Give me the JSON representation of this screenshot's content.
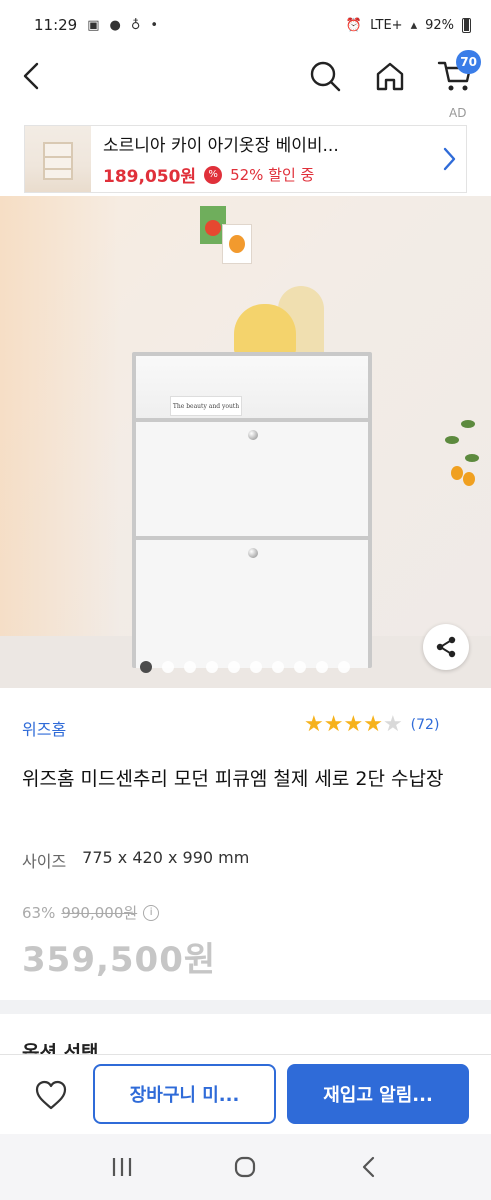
{
  "status_bar": {
    "time": "11:29",
    "network": "LTE+",
    "battery": "92%"
  },
  "header": {
    "cart_count": "70"
  },
  "ad": {
    "tag": "AD",
    "title": "소르니아 카이 아기옷장 베이비...",
    "price": "189,050원",
    "discount_icon": "%",
    "discount": "52% 할인 중"
  },
  "product_image": {
    "book_text": "The beauty and youth",
    "dot_count": 10,
    "active_dot": 0
  },
  "product": {
    "brand": "위즈홈",
    "rating": 4,
    "rating_max": 5,
    "review_count": "(72)",
    "title": "위즈홈 미드센추리 모던 피큐엠 철제 세로 2단 수납장",
    "size_label": "사이즈",
    "size_value": "775 x 420 x 990 mm",
    "discount_rate": "63%",
    "original_price": "990,000원",
    "info_icon": "i",
    "sale_price": "359,500원"
  },
  "options": {
    "title": "옵션 선택"
  },
  "actions": {
    "cart_button": "장바구니 미...",
    "restock_button": "재입고 알림..."
  },
  "colors": {
    "accent": "#2f6bd8",
    "sale_red": "#e0303a",
    "star": "#f6b21b"
  }
}
